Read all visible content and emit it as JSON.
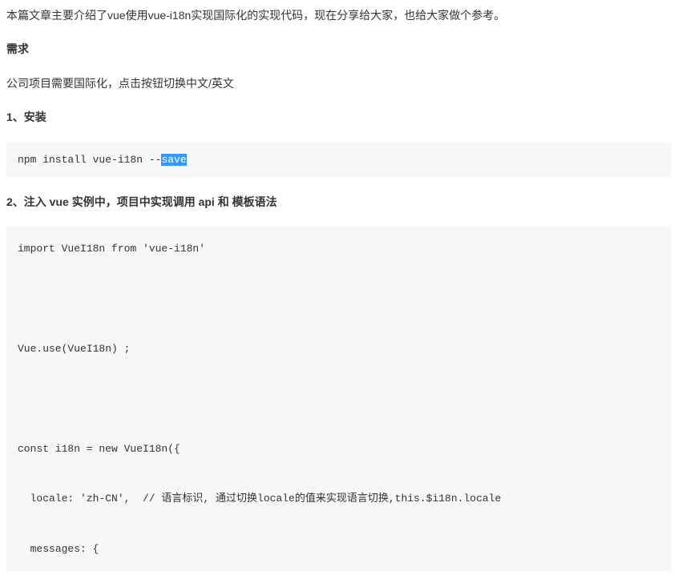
{
  "intro": "本篇文章主要介绍了vue使用vue-i18n实现国际化的实现代码，现在分享给大家，也给大家做个参考。",
  "headings": {
    "need": "需求",
    "install": "1、安装",
    "inject": "2、注入 vue 实例中，项目中实现调用 api 和 模板语法"
  },
  "need_desc": "公司项目需要国际化，点击按钮切换中文/英文",
  "code_install": {
    "prefix": "npm install vue-i18n --",
    "highlight": "save"
  },
  "code_inject": {
    "l1": "import VueI18n from 'vue-i18n'",
    "l2": "Vue.use(VueI18n) ;",
    "l3": "const i18n = new VueI18n({",
    "l4": "  locale: 'zh-CN',  // 语言标识, 通过切换locale的值来实现语言切换,this.$i18n.locale",
    "l5": "  messages: {"
  }
}
